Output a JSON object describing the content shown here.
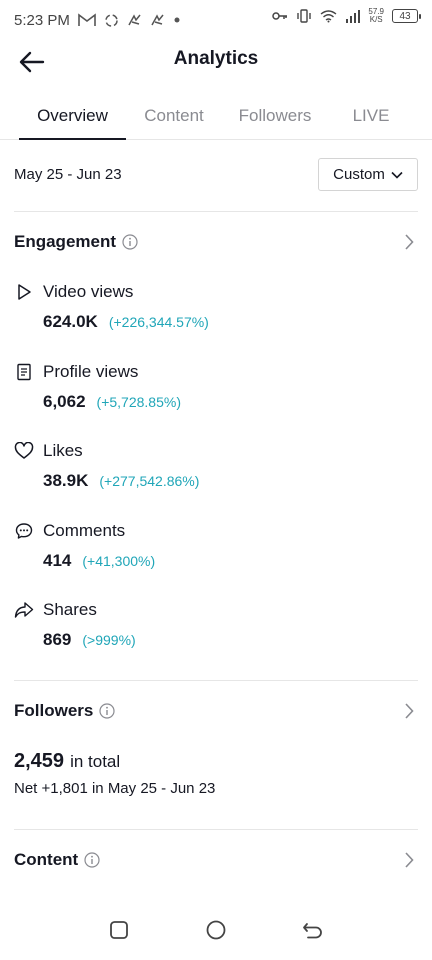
{
  "status_bar": {
    "time": "5:23 PM",
    "speed_value": "57.9",
    "speed_unit": "K/S",
    "battery": "43"
  },
  "header": {
    "title": "Analytics"
  },
  "tabs": [
    {
      "label": "Overview",
      "active": true
    },
    {
      "label": "Content",
      "active": false
    },
    {
      "label": "Followers",
      "active": false
    },
    {
      "label": "LIVE",
      "active": false
    }
  ],
  "date_filter": {
    "range": "May 25 - Jun 23",
    "button_label": "Custom"
  },
  "engagement": {
    "title": "Engagement",
    "metrics": [
      {
        "icon": "play-icon",
        "label": "Video views",
        "value": "624.0K",
        "change": "(+226,344.57%)"
      },
      {
        "icon": "profile-doc-icon",
        "label": "Profile views",
        "value": "6,062",
        "change": "(+5,728.85%)"
      },
      {
        "icon": "heart-icon",
        "label": "Likes",
        "value": "38.9K",
        "change": "(+277,542.86%)"
      },
      {
        "icon": "comment-icon",
        "label": "Comments",
        "value": "414",
        "change": "(+41,300%)"
      },
      {
        "icon": "share-icon",
        "label": "Shares",
        "value": "869",
        "change": "(>999%)"
      }
    ]
  },
  "followers": {
    "title": "Followers",
    "total": "2,459",
    "total_suffix": "in total",
    "net": "Net +1,801 in May 25 - Jun 23"
  },
  "content": {
    "title": "Content"
  },
  "colors": {
    "accent_change": "#20a6b8",
    "text": "#161823",
    "muted": "#8a8b91"
  }
}
